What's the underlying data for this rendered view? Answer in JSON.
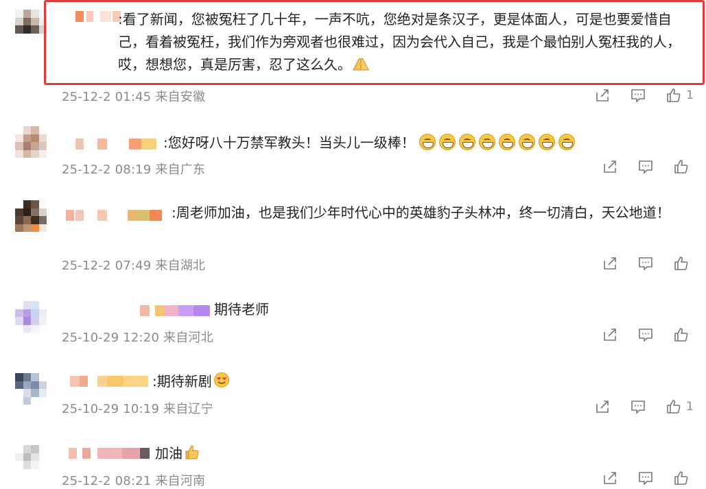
{
  "comments": [
    {
      "text": ":看了新闻，您被冤枉了几十年，一声不吭，您绝对是条汉子，更是体面人，可是也要爱惜自己，看着被冤枉，我们作为旁观者也很难过，因为会代入自己，我是个最怕别人冤枉我的人，哎，想想您，真是厉害，忍了这么久。",
      "emoji": "pray-hands-icon",
      "time": "25-12-2 01:45",
      "location": "来自安徽",
      "likes": "1"
    },
    {
      "text": ":您好呀八十万禁军教头！当头儿一级棒！",
      "emoji": "grin-face-icon x8",
      "time": "25-12-2 08:19",
      "location": "来自广东",
      "likes": ""
    },
    {
      "text": ":周老师加油，也是我们少年时代心中的英雄豹子头林冲，终一切清白，天公地道！",
      "time": "25-12-2 07:49",
      "location": "来自湖北",
      "likes": ""
    },
    {
      "text": "期待老师",
      "time": "25-10-29 12:20",
      "location": "来自河北",
      "likes": ""
    },
    {
      "text": ":期待新剧",
      "emoji": "heart-eyes-icon",
      "time": "25-10-29 10:19",
      "location": "来自辽宁",
      "likes": "1"
    },
    {
      "text": "加油",
      "emoji": "thumbs-up-icon",
      "time": "25-12-2 08:21",
      "location": "来自河南",
      "likes": ""
    }
  ],
  "colors": {
    "highlight_border": "#e23b3b",
    "meta_text": "#8a8a8a",
    "body_text": "#222222"
  }
}
